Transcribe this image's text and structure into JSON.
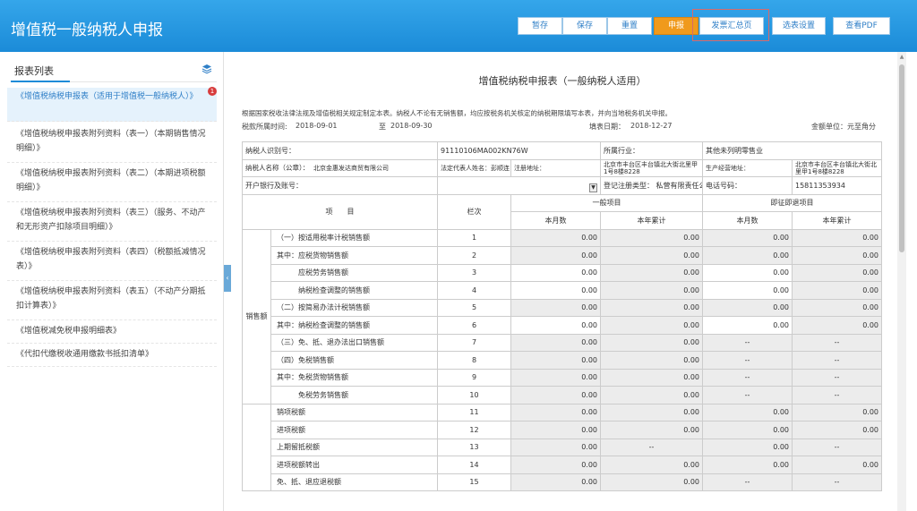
{
  "header": {
    "title": "增值税一般纳税人申报",
    "buttons": {
      "save_temp": "暂存",
      "save": "保存",
      "reset": "重置",
      "declare": "申报",
      "invoice_summary": "发票汇总页",
      "form_settings": "选表设置",
      "view_pdf": "查看PDF"
    }
  },
  "sidebar": {
    "title": "报表列表",
    "badge": "1",
    "items": [
      "《增值税纳税申报表（适用于增值税一般纳税人）》",
      "《增值税纳税申报表附列资料（表一）（本期销售情况明细）》",
      "《增值税纳税申报表附列资料（表二）（本期进项税额明细）》",
      "《增值税纳税申报表附列资料（表三）（服务、不动产和无形资产扣除项目明细）》",
      "《增值税纳税申报表附列资料（表四）（税额抵减情况表）》",
      "《增值税纳税申报表附列资料（表五）（不动产分期抵扣计算表）》",
      "《增值税减免税申报明细表》",
      "《代扣代缴税收通用缴款书抵扣清单》"
    ]
  },
  "form": {
    "title": "增值税纳税申报表（一般纳税人适用）",
    "intro": "根据国家税收法律法规及增值税相关规定制定本表。纳税人不论有无销售额，均应按税务机关核定的纳税期限填写本表，并向当地税务机关申报。",
    "period_label": "税款所属时间:",
    "period_start": "2018-09-01",
    "period_to": "至",
    "period_end": "2018-09-30",
    "fill_date_label": "填表日期：",
    "fill_date": "2018-12-27",
    "unit": "金额单位：元至角分",
    "taxpayer_id_label": "纳税人识别号：",
    "taxpayer_id": "91110106MA002KN76W",
    "industry_label": "所属行业：",
    "industry": "其他未列明零售业",
    "taxpayer_name_label": "纳税人名称（公章）：",
    "taxpayer_name": "北京金惠发达商贸有限公司",
    "legal_rep_label": "法定代表人姓名：",
    "legal_rep": "彭顺连",
    "reg_address_label": "注册地址：",
    "reg_address": "北京市丰台区丰台镇北大街北里甲1号8楼8228",
    "biz_address_label": "生产经营地址：",
    "biz_address": "北京市丰台区丰台镇北大街北里甲1号8楼8228",
    "bank_label": "开户银行及账号：",
    "reg_type_label": "登记注册类型：",
    "reg_type": "私营有限责任公司",
    "phone_label": "电话号码：",
    "phone": "15811353934",
    "col_item": "项　　目",
    "col_line": "栏次",
    "col_general": "一般项目",
    "col_refund": "即征即退项目",
    "col_month": "本月数",
    "col_ytd": "本年累计",
    "section_sales": "销售额",
    "rows": [
      {
        "label": "（一）按适用税率计税销售额",
        "line": "1",
        "v1": "0.00",
        "v2": "0.00",
        "v3": "0.00",
        "v4": "0.00"
      },
      {
        "label": "其中：应税货物销售额",
        "line": "2",
        "v1": "0.00",
        "v2": "0.00",
        "v3": "0.00",
        "v4": "0.00"
      },
      {
        "label": "应税劳务销售额",
        "line": "3",
        "v1": "0.00",
        "v2": "0.00",
        "v3": "0.00",
        "v4": "0.00"
      },
      {
        "label": "纳税检查调整的销售额",
        "line": "4",
        "v1": "0.00",
        "v2": "0.00",
        "v3": "0.00",
        "v4": "0.00"
      },
      {
        "label": "（二）按简易办法计税销售额",
        "line": "5",
        "v1": "0.00",
        "v2": "0.00",
        "v3": "0.00",
        "v4": "0.00"
      },
      {
        "label": "其中：纳税检查调整的销售额",
        "line": "6",
        "v1": "0.00",
        "v2": "0.00",
        "v3": "0.00",
        "v4": "0.00"
      },
      {
        "label": "（三）免、抵、退办法出口销售额",
        "line": "7",
        "v1": "0.00",
        "v2": "0.00",
        "v3": "--",
        "v4": "--"
      },
      {
        "label": "（四）免税销售额",
        "line": "8",
        "v1": "0.00",
        "v2": "0.00",
        "v3": "--",
        "v4": "--"
      },
      {
        "label": "其中：免税货物销售额",
        "line": "9",
        "v1": "0.00",
        "v2": "0.00",
        "v3": "--",
        "v4": "--"
      },
      {
        "label": "免税劳务销售额",
        "line": "10",
        "v1": "0.00",
        "v2": "0.00",
        "v3": "--",
        "v4": "--"
      },
      {
        "label": "销项税额",
        "line": "11",
        "v1": "0.00",
        "v2": "0.00",
        "v3": "0.00",
        "v4": "0.00"
      },
      {
        "label": "进项税额",
        "line": "12",
        "v1": "0.00",
        "v2": "0.00",
        "v3": "0.00",
        "v4": "0.00"
      },
      {
        "label": "上期留抵税额",
        "line": "13",
        "v1": "0.00",
        "v2": "--",
        "v3": "0.00",
        "v4": "--"
      },
      {
        "label": "进项税额转出",
        "line": "14",
        "v1": "0.00",
        "v2": "0.00",
        "v3": "0.00",
        "v4": "0.00"
      },
      {
        "label": "免、抵、退应退税额",
        "line": "15",
        "v1": "0.00",
        "v2": "0.00",
        "v3": "--",
        "v4": "--"
      }
    ]
  }
}
